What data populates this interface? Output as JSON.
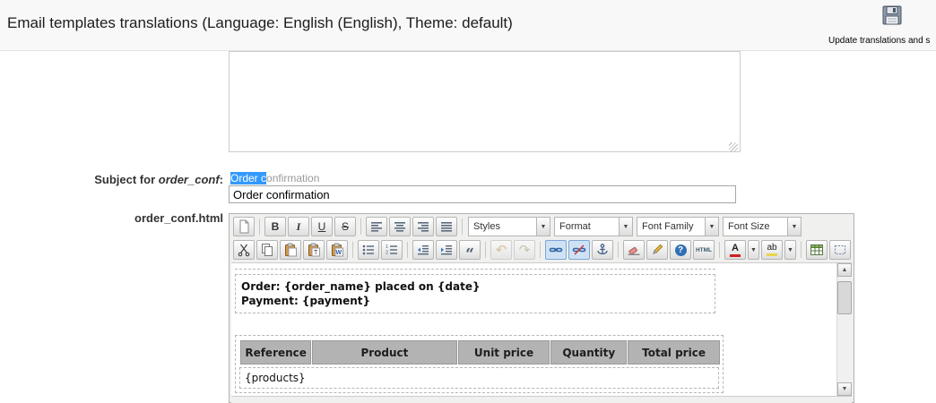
{
  "header": {
    "title": "Email templates translations (Language: English (English), Theme: default)",
    "save_label": "Update translations and s"
  },
  "subject_row": {
    "label_prefix": "Subject for ",
    "label_code": "order_conf",
    "label_suffix": ":",
    "suggestion_selected": "Order c",
    "suggestion_rest": "onfirmation",
    "input_value": "Order confirmation"
  },
  "editor_row": {
    "label": "order_conf.html"
  },
  "toolbar": {
    "bold": "B",
    "italic": "I",
    "underline": "U",
    "strikethrough": "S",
    "styles": "Styles",
    "format": "Format",
    "font_family": "Font Family",
    "font_size": "Font Size",
    "blockquote": "“",
    "undo": "↶",
    "redo": "↷",
    "help": "?",
    "html": "HTML",
    "forecolor_letter": "A",
    "backcolor_letters": "ab"
  },
  "icons": {
    "dropdown_arrow": "▼",
    "scroll_up": "▲",
    "scroll_down": "▼"
  },
  "editor_content": {
    "line1": "Order: {order_name} placed on {date}",
    "line2": "Payment: {payment}",
    "table_headers": [
      "Reference",
      "Product",
      "Unit price",
      "Quantity",
      "Total price"
    ],
    "products": "{products}"
  },
  "colors": {
    "selection": "#3399fe",
    "table_header_bg": "#b3b3b3",
    "active_button_bg": "#cfe2f5"
  }
}
